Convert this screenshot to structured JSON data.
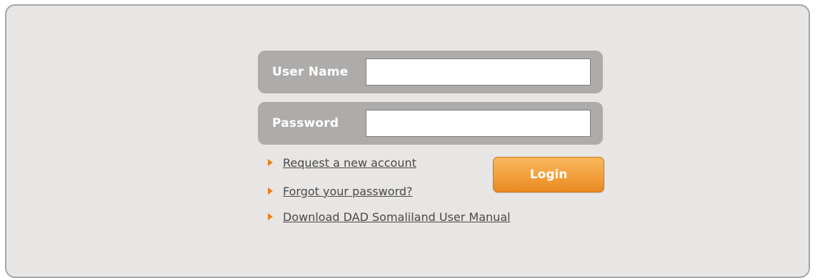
{
  "login_form": {
    "username": {
      "label": "User Name",
      "value": "",
      "placeholder": ""
    },
    "password": {
      "label": "Password",
      "value": "",
      "placeholder": ""
    },
    "login_button_label": "Login",
    "links": [
      {
        "label": "Request a new account"
      },
      {
        "label": "Forgot your password?"
      },
      {
        "label": "Download DAD Somaliland User Manual"
      }
    ]
  },
  "colors": {
    "panel_background": "#e8e6e4",
    "field_row_background": "#aeacab",
    "accent_orange": "#f3a23e",
    "arrow_orange": "#e8821c",
    "link_text": "#4a4a4a"
  },
  "icons": {
    "link_bullet": "orange-triangle-arrow-icon"
  }
}
